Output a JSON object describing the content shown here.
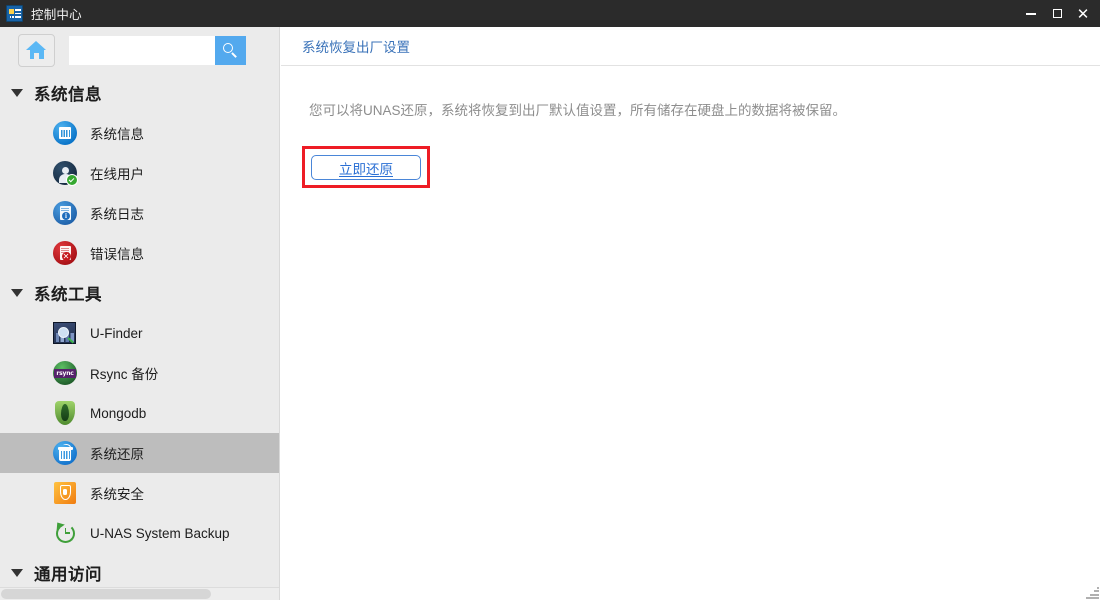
{
  "window": {
    "title": "控制中心",
    "icon": "control-center-icon",
    "controls": {
      "minimize": "–",
      "maximize": "□",
      "close": "✕"
    }
  },
  "sidebar": {
    "home_button": {
      "icon": "home-icon",
      "label": ""
    },
    "search": {
      "value": "",
      "placeholder": "",
      "button_icon": "search-icon"
    },
    "groups": [
      {
        "label": "系统信息",
        "expanded": true,
        "arrow": "chevron-down-icon",
        "items": [
          {
            "label": "系统信息",
            "icon": "system-info-icon",
            "selected": false
          },
          {
            "label": "在线用户",
            "icon": "online-user-icon",
            "selected": false
          },
          {
            "label": "系统日志",
            "icon": "system-log-icon",
            "selected": false
          },
          {
            "label": "错误信息",
            "icon": "error-info-icon",
            "selected": false
          }
        ]
      },
      {
        "label": "系统工具",
        "expanded": true,
        "arrow": "chevron-down-icon",
        "items": [
          {
            "label": "U-Finder",
            "icon": "u-finder-icon",
            "selected": false
          },
          {
            "label": "Rsync 备份",
            "icon": "rsync-icon",
            "selected": false
          },
          {
            "label": "Mongodb",
            "icon": "mongodb-icon",
            "selected": false
          },
          {
            "label": "系统还原",
            "icon": "system-restore-icon",
            "selected": true
          },
          {
            "label": "系统安全",
            "icon": "system-security-icon",
            "selected": false
          },
          {
            "label": "U-NAS System Backup",
            "icon": "unas-system-backup-icon",
            "selected": false
          }
        ]
      },
      {
        "label": "通用访问",
        "expanded": true,
        "arrow": "chevron-down-icon",
        "items": []
      }
    ]
  },
  "main": {
    "header_title": "系统恢复出厂设置",
    "description": "您可以将UNAS还原，系统将恢复到出厂默认值设置，所有储存在硬盘上的数据将被保留。",
    "restore_button": "立即还原"
  },
  "colors": {
    "titlebar_bg": "#2b2b2b",
    "sidebar_bg": "#ebebeb",
    "selected_row": "#bdbdbd",
    "header_link": "#3b73b9",
    "accent_blue": "#53a9ee",
    "button_border": "#4a86d8",
    "button_text": "#2a6fd4",
    "highlight_box": "#ee1c25",
    "description_text": "#8d8d8d"
  }
}
